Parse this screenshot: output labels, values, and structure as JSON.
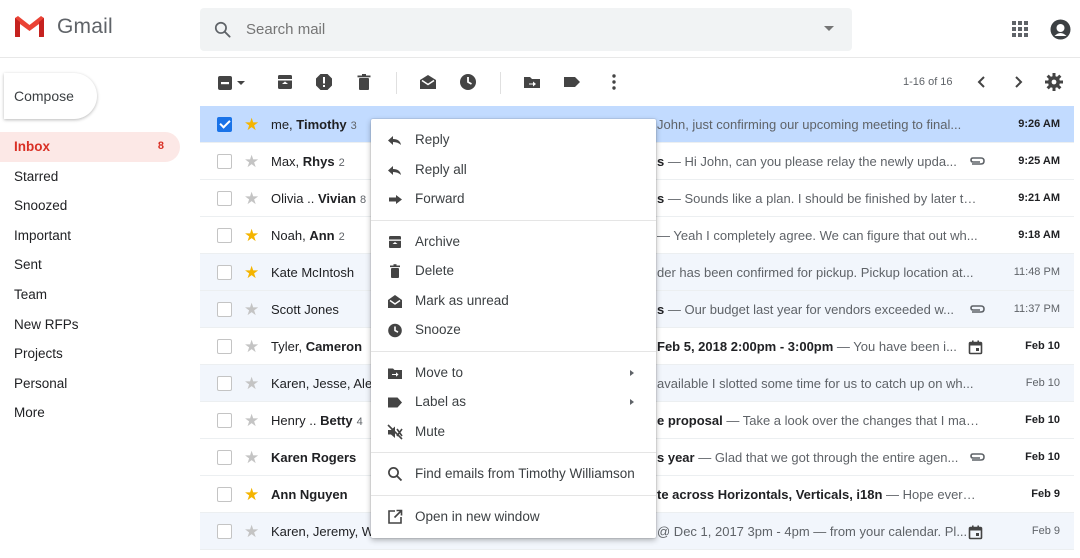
{
  "header": {
    "app_name": "Gmail",
    "search_placeholder": "Search mail"
  },
  "sidebar": {
    "compose_label": "Compose",
    "items": [
      {
        "label": "Inbox",
        "count": "8"
      },
      {
        "label": "Starred"
      },
      {
        "label": "Snoozed"
      },
      {
        "label": "Important"
      },
      {
        "label": "Sent"
      },
      {
        "label": "Team"
      },
      {
        "label": "New RFPs"
      },
      {
        "label": "Projects"
      },
      {
        "label": "Personal"
      },
      {
        "label": "More"
      }
    ]
  },
  "toolbar": {
    "pager_text": "1-16 of 16"
  },
  "mail": [
    {
      "sender_plain": "me, ",
      "sender_bold": "Timothy",
      "count": "3",
      "subject": "",
      "snippet": "John, just confirming our upcoming meeting to final...",
      "date": "9:26 AM",
      "starred": true,
      "selected": true,
      "unread": true,
      "attachment": false,
      "calendar": false
    },
    {
      "sender_plain": "Max, ",
      "sender_bold": "Rhys",
      "count": "2",
      "subject": "s",
      "snippet": " — Hi John, can you please relay the newly upda...",
      "date": "9:25 AM",
      "starred": false,
      "selected": false,
      "unread": true,
      "attachment": true,
      "calendar": false
    },
    {
      "sender_plain": "Olivia .. ",
      "sender_bold": "Vivian",
      "count": "8",
      "subject": "s",
      "snippet": " — Sounds like a plan. I should be finished by later toni...",
      "date": "9:21 AM",
      "starred": false,
      "selected": false,
      "unread": true,
      "attachment": false,
      "calendar": false
    },
    {
      "sender_plain": "Noah, ",
      "sender_bold": "Ann",
      "count": "2",
      "subject": "",
      "snippet": "— Yeah I completely agree. We can figure that out wh...",
      "date": "9:18 AM",
      "starred": true,
      "selected": false,
      "unread": true,
      "attachment": false,
      "calendar": false
    },
    {
      "sender_plain": "Kate McIntosh",
      "sender_bold": "",
      "count": "",
      "subject": "",
      "snippet": "der has been confirmed for pickup. Pickup location at...",
      "date": "11:48 PM",
      "starred": true,
      "selected": false,
      "unread": false,
      "attachment": false,
      "calendar": false
    },
    {
      "sender_plain": "Scott Jones",
      "sender_bold": "",
      "count": "",
      "subject": "s",
      "snippet": " — Our budget last year for vendors exceeded w...",
      "date": "11:37 PM",
      "starred": false,
      "selected": false,
      "unread": false,
      "attachment": true,
      "calendar": false
    },
    {
      "sender_plain": "Tyler, ",
      "sender_bold": "Cameron",
      "count": "",
      "subject": "Feb 5, 2018 2:00pm - 3:00pm",
      "snippet": " — You have been i...",
      "date": "Feb 10",
      "starred": false,
      "selected": false,
      "unread": true,
      "attachment": false,
      "calendar": true
    },
    {
      "sender_plain": "Karen, Jesse, Ale",
      "sender_bold": "",
      "count": "",
      "subject": "",
      "snippet": "available I slotted some time for us to catch up on wh...",
      "date": "Feb 10",
      "starred": false,
      "selected": false,
      "unread": false,
      "attachment": false,
      "calendar": false
    },
    {
      "sender_plain": "Henry .. ",
      "sender_bold": "Betty",
      "count": "4",
      "subject": "e proposal",
      "snippet": " — Take a look over the changes that I mad...",
      "date": "Feb 10",
      "starred": false,
      "selected": false,
      "unread": true,
      "attachment": false,
      "calendar": false
    },
    {
      "sender_plain": "",
      "sender_bold": "Karen Rogers",
      "count": "",
      "subject": "s year",
      "snippet": " — Glad that we got through the entire agen...",
      "date": "Feb 10",
      "starred": false,
      "selected": false,
      "unread": true,
      "attachment": true,
      "calendar": false
    },
    {
      "sender_plain": "",
      "sender_bold": "Ann Nguyen",
      "count": "",
      "subject": "te across Horizontals, Verticals, i18n",
      "snippet": " — Hope everyo...",
      "date": "Feb 9",
      "starred": true,
      "selected": false,
      "unread": true,
      "attachment": false,
      "calendar": false
    },
    {
      "sender_plain": "Karen, Jeremy, W",
      "sender_bold": "",
      "count": "",
      "subject": "",
      "snippet": "@ Dec 1, 2017 3pm - 4pm — from your calendar. Pl...",
      "date": "Feb 9",
      "starred": false,
      "selected": false,
      "unread": false,
      "attachment": false,
      "calendar": true
    }
  ],
  "context_menu": {
    "groups": [
      [
        {
          "label": "Reply",
          "icon": "reply-icon"
        },
        {
          "label": "Reply all",
          "icon": "reply-all-icon"
        },
        {
          "label": "Forward",
          "icon": "forward-icon"
        }
      ],
      [
        {
          "label": "Archive",
          "icon": "archive-icon"
        },
        {
          "label": "Delete",
          "icon": "delete-icon"
        },
        {
          "label": "Mark as unread",
          "icon": "mark-unread-icon"
        },
        {
          "label": "Snooze",
          "icon": "snooze-icon"
        }
      ],
      [
        {
          "label": "Move to",
          "icon": "move-to-icon",
          "submenu": true
        },
        {
          "label": "Label as",
          "icon": "label-icon",
          "submenu": true
        },
        {
          "label": "Mute",
          "icon": "mute-icon"
        }
      ],
      [
        {
          "label": "Find emails from Timothy Williamson",
          "icon": "search-icon"
        }
      ],
      [
        {
          "label": "Open in new window",
          "icon": "open-new-window-icon"
        }
      ]
    ]
  },
  "colors": {
    "gmail_red": "#ea4335",
    "inbox_active_bg": "#fce8e6",
    "selected_row_bg": "#c2dbff",
    "star_on": "#f4b400"
  }
}
